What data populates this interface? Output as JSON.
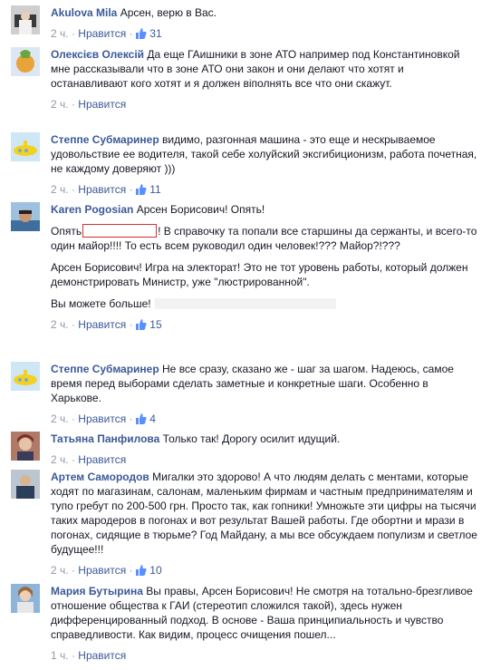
{
  "ui": {
    "like_label": "Нравится",
    "sep": "·"
  },
  "comments": [
    {
      "author": "Akulova Mila",
      "text": "Арсен, верю в Вас.",
      "time": "2 ч.",
      "likes": "31"
    },
    {
      "author": "Олексієв Олексій",
      "text": "Да еще ГАишники в зоне АТО например под Константиновкой мне рассказывали что в зоне АТО они закон и они делают что хотят и останавливают кого хотят и я должен віполнять все что они скажут.",
      "time": "2 ч.",
      "likes": ""
    },
    {
      "author": "Степпе Субмаринер",
      "text": "видимо, разгонная машина - это еще и нескрываемое удовольствие ее водителя, такой себе холуйский эксгибиционизм, работа почетная, не каждому доверяют )))",
      "time": "2 ч.",
      "likes": "11"
    },
    {
      "author": "Karen Pogosian",
      "text": "Арсен Борисович! Опять!",
      "p1a": "Опять",
      "p1b": "! В справочку та попали все старшины да сержанты, и всего-то один майор!!!! То есть всем руководил один человек!??? Майор?!???",
      "p2": "Арсен Борисович! Игра на электорат! Это не тот уровень работы, который должен демонстрировать Министр, уже \"люстрированной\".",
      "p3": "Вы можете больше!",
      "time": "2 ч.",
      "likes": "15"
    },
    {
      "author": "Степпе Субмаринер",
      "text": "Не все сразу, сказано же - шаг за шагом. Надеюсь, самое время перед выборами сделать заметные и конкретные шаги. Особенно в Харькове.",
      "time": "2 ч.",
      "likes": "4"
    },
    {
      "author": "Татьяна Панфилова",
      "text": "Только так! Дорогу осилит идущий.",
      "time": "2 ч.",
      "likes": ""
    },
    {
      "author": "Артем Самородов",
      "text": "Мигалки это здорово! А что людям делать с ментами, которые ходят по магазинам, салонам, маленьким фирмам и частным предпринимателям и тупо гребут по 200-500 грн. Просто так, как гопники! Умножьте эти цифры на тысячи таких мародеров в погонах и вот результат Вашей работы. Где обортни и мрази в погонах, сидящие в тюрьме? Год Майдану, а мы все обсуждаем популизм и светлое будущее!!!",
      "time": "2 ч.",
      "likes": "10"
    },
    {
      "author": "Мария Бутырина",
      "text": "Вы правы, Арсен Борисович! Не смотря на тотально-брезгливое отношение общества к ГАИ (стереотип сложился такой), здесь нужен дифференцированный подход. В основе - Ваша принципиальность и чувство справедливости. Как видим, процесс очищения пошел...",
      "time": "1 ч.",
      "likes": ""
    }
  ]
}
